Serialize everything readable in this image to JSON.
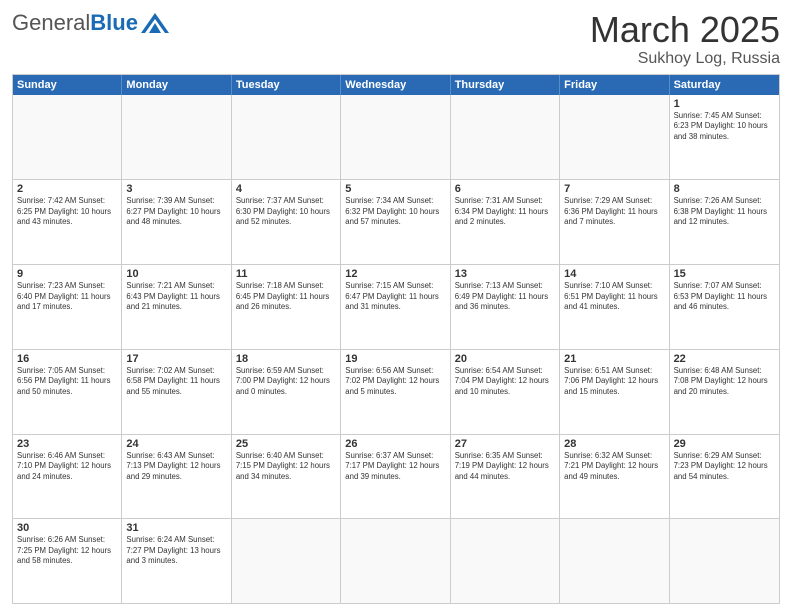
{
  "header": {
    "logo_general": "General",
    "logo_blue": "Blue",
    "month_title": "March 2025",
    "location": "Sukhoy Log, Russia"
  },
  "calendar": {
    "days_of_week": [
      "Sunday",
      "Monday",
      "Tuesday",
      "Wednesday",
      "Thursday",
      "Friday",
      "Saturday"
    ],
    "weeks": [
      [
        {
          "day": "",
          "info": ""
        },
        {
          "day": "",
          "info": ""
        },
        {
          "day": "",
          "info": ""
        },
        {
          "day": "",
          "info": ""
        },
        {
          "day": "",
          "info": ""
        },
        {
          "day": "",
          "info": ""
        },
        {
          "day": "1",
          "info": "Sunrise: 7:45 AM\nSunset: 6:23 PM\nDaylight: 10 hours\nand 38 minutes."
        }
      ],
      [
        {
          "day": "2",
          "info": "Sunrise: 7:42 AM\nSunset: 6:25 PM\nDaylight: 10 hours\nand 43 minutes."
        },
        {
          "day": "3",
          "info": "Sunrise: 7:39 AM\nSunset: 6:27 PM\nDaylight: 10 hours\nand 48 minutes."
        },
        {
          "day": "4",
          "info": "Sunrise: 7:37 AM\nSunset: 6:30 PM\nDaylight: 10 hours\nand 52 minutes."
        },
        {
          "day": "5",
          "info": "Sunrise: 7:34 AM\nSunset: 6:32 PM\nDaylight: 10 hours\nand 57 minutes."
        },
        {
          "day": "6",
          "info": "Sunrise: 7:31 AM\nSunset: 6:34 PM\nDaylight: 11 hours\nand 2 minutes."
        },
        {
          "day": "7",
          "info": "Sunrise: 7:29 AM\nSunset: 6:36 PM\nDaylight: 11 hours\nand 7 minutes."
        },
        {
          "day": "8",
          "info": "Sunrise: 7:26 AM\nSunset: 6:38 PM\nDaylight: 11 hours\nand 12 minutes."
        }
      ],
      [
        {
          "day": "9",
          "info": "Sunrise: 7:23 AM\nSunset: 6:40 PM\nDaylight: 11 hours\nand 17 minutes."
        },
        {
          "day": "10",
          "info": "Sunrise: 7:21 AM\nSunset: 6:43 PM\nDaylight: 11 hours\nand 21 minutes."
        },
        {
          "day": "11",
          "info": "Sunrise: 7:18 AM\nSunset: 6:45 PM\nDaylight: 11 hours\nand 26 minutes."
        },
        {
          "day": "12",
          "info": "Sunrise: 7:15 AM\nSunset: 6:47 PM\nDaylight: 11 hours\nand 31 minutes."
        },
        {
          "day": "13",
          "info": "Sunrise: 7:13 AM\nSunset: 6:49 PM\nDaylight: 11 hours\nand 36 minutes."
        },
        {
          "day": "14",
          "info": "Sunrise: 7:10 AM\nSunset: 6:51 PM\nDaylight: 11 hours\nand 41 minutes."
        },
        {
          "day": "15",
          "info": "Sunrise: 7:07 AM\nSunset: 6:53 PM\nDaylight: 11 hours\nand 46 minutes."
        }
      ],
      [
        {
          "day": "16",
          "info": "Sunrise: 7:05 AM\nSunset: 6:56 PM\nDaylight: 11 hours\nand 50 minutes."
        },
        {
          "day": "17",
          "info": "Sunrise: 7:02 AM\nSunset: 6:58 PM\nDaylight: 11 hours\nand 55 minutes."
        },
        {
          "day": "18",
          "info": "Sunrise: 6:59 AM\nSunset: 7:00 PM\nDaylight: 12 hours\nand 0 minutes."
        },
        {
          "day": "19",
          "info": "Sunrise: 6:56 AM\nSunset: 7:02 PM\nDaylight: 12 hours\nand 5 minutes."
        },
        {
          "day": "20",
          "info": "Sunrise: 6:54 AM\nSunset: 7:04 PM\nDaylight: 12 hours\nand 10 minutes."
        },
        {
          "day": "21",
          "info": "Sunrise: 6:51 AM\nSunset: 7:06 PM\nDaylight: 12 hours\nand 15 minutes."
        },
        {
          "day": "22",
          "info": "Sunrise: 6:48 AM\nSunset: 7:08 PM\nDaylight: 12 hours\nand 20 minutes."
        }
      ],
      [
        {
          "day": "23",
          "info": "Sunrise: 6:46 AM\nSunset: 7:10 PM\nDaylight: 12 hours\nand 24 minutes."
        },
        {
          "day": "24",
          "info": "Sunrise: 6:43 AM\nSunset: 7:13 PM\nDaylight: 12 hours\nand 29 minutes."
        },
        {
          "day": "25",
          "info": "Sunrise: 6:40 AM\nSunset: 7:15 PM\nDaylight: 12 hours\nand 34 minutes."
        },
        {
          "day": "26",
          "info": "Sunrise: 6:37 AM\nSunset: 7:17 PM\nDaylight: 12 hours\nand 39 minutes."
        },
        {
          "day": "27",
          "info": "Sunrise: 6:35 AM\nSunset: 7:19 PM\nDaylight: 12 hours\nand 44 minutes."
        },
        {
          "day": "28",
          "info": "Sunrise: 6:32 AM\nSunset: 7:21 PM\nDaylight: 12 hours\nand 49 minutes."
        },
        {
          "day": "29",
          "info": "Sunrise: 6:29 AM\nSunset: 7:23 PM\nDaylight: 12 hours\nand 54 minutes."
        }
      ],
      [
        {
          "day": "30",
          "info": "Sunrise: 6:26 AM\nSunset: 7:25 PM\nDaylight: 12 hours\nand 58 minutes."
        },
        {
          "day": "31",
          "info": "Sunrise: 6:24 AM\nSunset: 7:27 PM\nDaylight: 13 hours\nand 3 minutes."
        },
        {
          "day": "",
          "info": ""
        },
        {
          "day": "",
          "info": ""
        },
        {
          "day": "",
          "info": ""
        },
        {
          "day": "",
          "info": ""
        },
        {
          "day": "",
          "info": ""
        }
      ]
    ]
  }
}
